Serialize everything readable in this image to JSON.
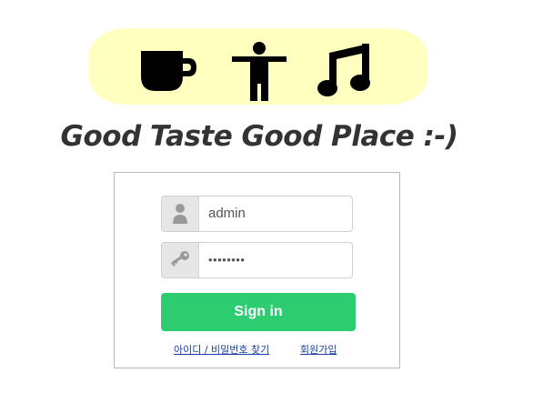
{
  "header": {
    "icons": [
      "coffee-cup-icon",
      "accessibility-person-icon",
      "music-note-icon"
    ],
    "tagline": "Good Taste Good Place :-)",
    "banner_color": "#ffffc0"
  },
  "login": {
    "username_value": "admin",
    "password_value": "••••••••",
    "username_icon": "user-icon",
    "password_icon": "key-icon",
    "signin_label": "Sign in",
    "signin_color": "#2ecc71",
    "find_link": "아이디 / 비밀번호 찾기",
    "join_link": "회원가입"
  }
}
